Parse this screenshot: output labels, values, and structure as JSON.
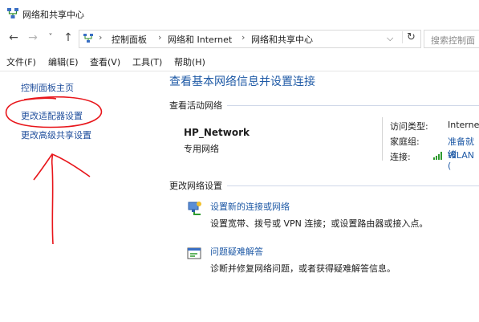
{
  "window": {
    "title": "网络和共享中心"
  },
  "nav": {
    "back": "←",
    "forward": "→",
    "recent": "˅",
    "up": "↑",
    "breadcrumbs": [
      "控制面板",
      "网络和 Internet",
      "网络和共享中心"
    ],
    "breadcrumb_sep": "›",
    "dropdown": "⌵",
    "refresh": "↻",
    "search_placeholder": "搜索控制面"
  },
  "menubar": {
    "items": [
      "文件(F)",
      "编辑(E)",
      "查看(V)",
      "工具(T)",
      "帮助(H)"
    ]
  },
  "sidebar": {
    "items": [
      {
        "label": "控制面板主页"
      },
      {
        "label": "更改适配器设置"
      },
      {
        "label": "更改高级共享设置"
      }
    ]
  },
  "main": {
    "title": "查看基本网络信息并设置连接",
    "active_networks_heading": "查看活动网络",
    "network": {
      "name": "HP_Network",
      "category": "专用网络",
      "access_type_label": "访问类型:",
      "access_type_value": "Interne",
      "homegroup_label": "家庭组:",
      "homegroup_value": "准备就绪",
      "connections_label": "连接:",
      "connections_value": "WLAN ("
    },
    "change_settings_heading": "更改网络设置",
    "tasks": [
      {
        "link": "设置新的连接或网络",
        "desc": "设置宽带、拨号或 VPN 连接；或设置路由器或接入点。"
      },
      {
        "link": "问题疑难解答",
        "desc": "诊断并修复网络问题，或者获得疑难解答信息。"
      }
    ]
  },
  "colors": {
    "link": "#1f4e9c",
    "title_blue": "#1f5aa6",
    "annotation_red": "#e8161b"
  }
}
